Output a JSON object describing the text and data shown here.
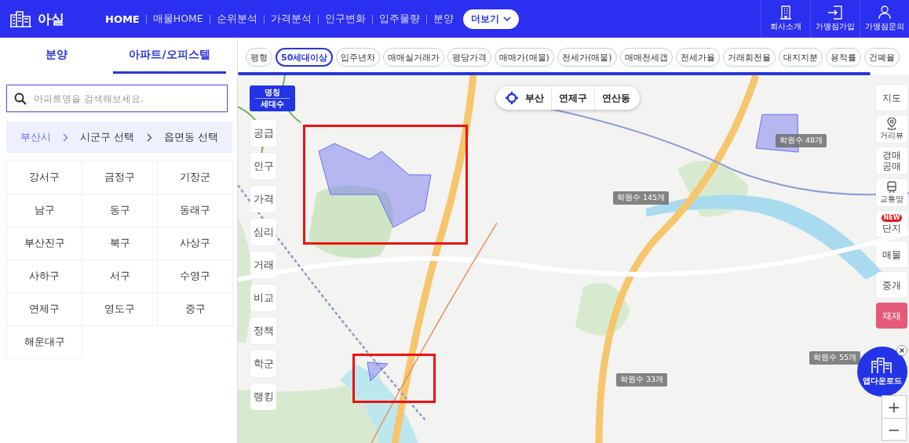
{
  "header": {
    "logo_text": "아실",
    "nav": [
      {
        "label": "HOME",
        "selected": true
      },
      {
        "label": "매물HOME",
        "selected": false
      },
      {
        "label": "순위분석",
        "selected": false
      },
      {
        "label": "가격분석",
        "selected": false
      },
      {
        "label": "인구변화",
        "selected": false
      },
      {
        "label": "입주물량",
        "selected": false
      },
      {
        "label": "분양",
        "selected": false
      }
    ],
    "more_button": "더보기",
    "right_links": [
      {
        "label": "회사소개",
        "kind": "building"
      },
      {
        "label": "가맹점가입",
        "kind": "signin"
      },
      {
        "label": "가맹점문의",
        "kind": "person"
      }
    ]
  },
  "sidebar": {
    "tabs": [
      {
        "label": "분양",
        "selected": false
      },
      {
        "label": "아파트/오피스텔",
        "selected": true
      }
    ],
    "search": {
      "placeholder": "아파트명을 검색해보세요."
    },
    "breadcrumb": [
      {
        "label": "부산시",
        "selected": true
      },
      {
        "label": "시군구 선택",
        "selected": false
      },
      {
        "label": "읍면동 선택",
        "selected": false
      }
    ],
    "districts": [
      "강서구",
      "금정구",
      "기장군",
      "남구",
      "동구",
      "동래구",
      "부산진구",
      "북구",
      "사상구",
      "사하구",
      "서구",
      "수영구",
      "연제구",
      "영도구",
      "중구",
      "해운대구"
    ]
  },
  "filters": [
    {
      "label": "평형",
      "selected": false
    },
    {
      "label": "50세대이상",
      "selected": true
    },
    {
      "label": "입주년차",
      "selected": false
    },
    {
      "label": "매매실거래가",
      "selected": false
    },
    {
      "label": "평당가격",
      "selected": false
    },
    {
      "label": "매매가(매물)",
      "selected": false
    },
    {
      "label": "전세가(매물)",
      "selected": false
    },
    {
      "label": "매매전세갭",
      "selected": false
    },
    {
      "label": "전세가율",
      "selected": false
    },
    {
      "label": "거래회전율",
      "selected": false
    },
    {
      "label": "대지지분",
      "selected": false
    },
    {
      "label": "용적률",
      "selected": false
    },
    {
      "label": "건폐율",
      "selected": false
    }
  ],
  "map": {
    "name_toggle": [
      "명칭",
      "세대수"
    ],
    "layers": [
      "공급",
      "인구",
      "가격",
      "심리",
      "거래",
      "비교",
      "정책",
      "학군",
      "랭킹"
    ],
    "location": [
      "부산",
      "연제구",
      "연산동"
    ],
    "right_tools": [
      {
        "label": "지도",
        "kind": "text",
        "selected": false
      },
      {
        "label": "거리뷰",
        "kind": "streetview",
        "selected": false
      },
      {
        "label": "경매\n공매",
        "kind": "text",
        "selected": false
      },
      {
        "label": "교통망",
        "kind": "transit",
        "selected": false
      },
      {
        "label": "단지",
        "kind": "text",
        "selected": false,
        "badge": "NEW"
      },
      {
        "label": "매물",
        "kind": "text",
        "selected": false
      },
      {
        "label": "중개",
        "kind": "text",
        "selected": false
      },
      {
        "label": "재재",
        "kind": "text",
        "selected": true
      }
    ],
    "academy_badges": [
      "학원수 145개",
      "학원수 33개",
      "학원수 48개",
      "학원수 55개"
    ],
    "app_download": "앱다운로드",
    "zoom": [
      "+",
      "−"
    ]
  }
}
